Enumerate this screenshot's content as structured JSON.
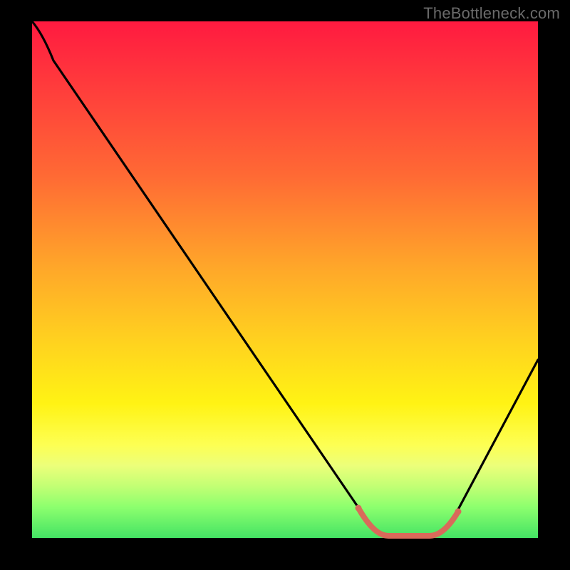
{
  "watermark": "TheBottleneck.com",
  "colors": {
    "background": "#000000",
    "grad_top": "#ff1a40",
    "grad_bottom": "#44e364",
    "curve": "#000000",
    "highlight": "#d96a5a"
  },
  "chart_data": {
    "type": "line",
    "title": "",
    "xlabel": "",
    "ylabel": "",
    "xlim": [
      0,
      100
    ],
    "ylim": [
      0,
      100
    ],
    "x": [
      0,
      4,
      10,
      20,
      30,
      40,
      50,
      60,
      64,
      66,
      70,
      74,
      78,
      80,
      84,
      90,
      96,
      100
    ],
    "values": [
      100,
      97,
      90,
      78,
      65,
      52,
      38,
      22,
      12,
      8,
      2,
      0,
      0,
      1,
      5,
      14,
      26,
      35
    ],
    "highlight_range_x": [
      64,
      82
    ],
    "grid": false,
    "annotations": []
  }
}
